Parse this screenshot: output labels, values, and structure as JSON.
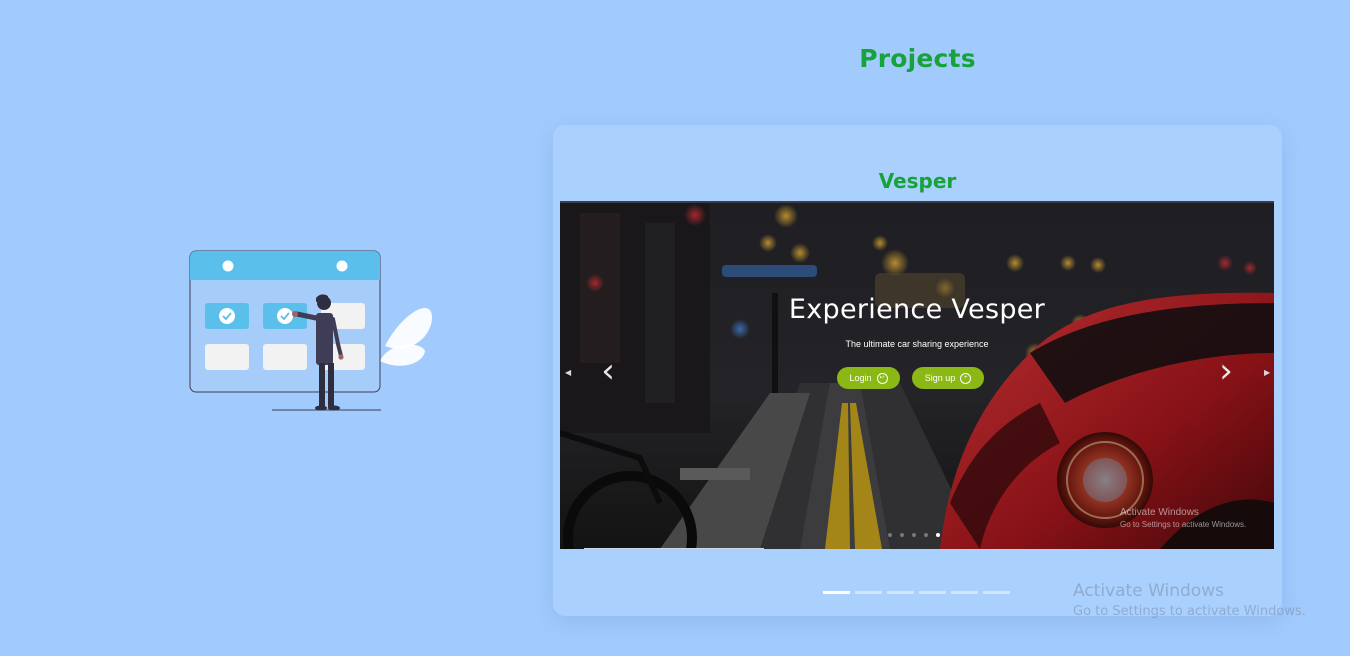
{
  "section": {
    "title": "Projects"
  },
  "illustration": {
    "name": "calendar-checklist-illustration"
  },
  "card": {
    "title": "Vesper",
    "screenshot": {
      "hero_title": "Experience Vesper",
      "hero_subtitle": "The ultimate car sharing experience",
      "login_label": "Login",
      "signup_label": "Sign up",
      "watermark_line1": "Activate Windows",
      "watermark_line2": "Go to Settings to activate Windows.",
      "dots": [
        false,
        false,
        false,
        false,
        true
      ]
    },
    "indicators": [
      true,
      false,
      false,
      false,
      false,
      false
    ]
  },
  "watermark": {
    "line1": "Activate Windows",
    "line2": "Go to Settings to activate Windows."
  },
  "colors": {
    "page_bg": "#a2cbfd",
    "card_bg": "#aad1fd",
    "accent_green": "#17a33a",
    "button_green": "#8bb814",
    "calendar_blue": "#5bbfeb"
  }
}
